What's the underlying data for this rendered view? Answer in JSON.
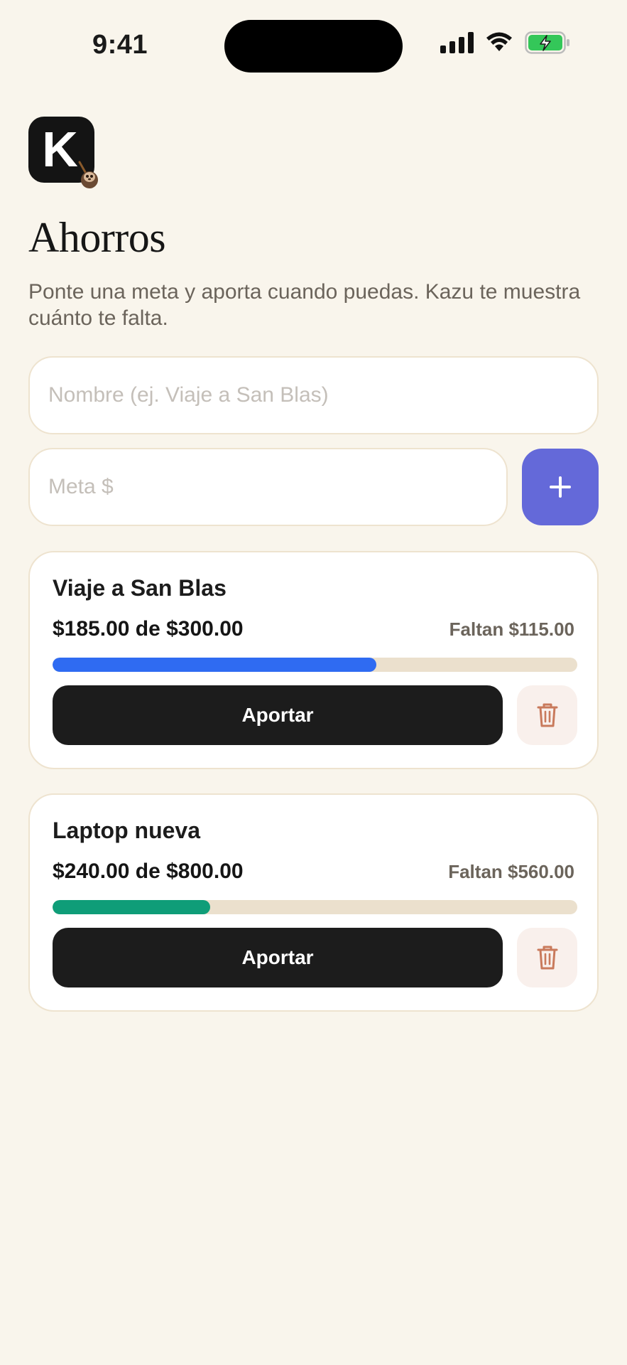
{
  "status_bar": {
    "time": "9:41"
  },
  "logo": {
    "letter": "K"
  },
  "header": {
    "title": "Ahorros",
    "subtitle": "Ponte una meta y aporta cuando puedas. Kazu te muestra cuánto te falta."
  },
  "form": {
    "name_placeholder": "Nombre (ej. Viaje a San Blas)",
    "goal_placeholder": "Meta $",
    "add_icon": "plus-icon"
  },
  "goals": [
    {
      "name": "Viaje a San Blas",
      "amount_text": "$185.00 de $300.00",
      "remaining_text": "Faltan $115.00",
      "saved": 185.0,
      "target": 300.0,
      "progress_color": "#2f6bf2",
      "contribute_label": "Aportar",
      "delete_icon": "trash-icon"
    },
    {
      "name": "Laptop nueva",
      "amount_text": "$240.00 de $800.00",
      "remaining_text": "Faltan $560.00",
      "saved": 240.0,
      "target": 800.0,
      "progress_color": "#0f9d78",
      "contribute_label": "Aportar",
      "delete_icon": "trash-icon"
    }
  ],
  "colors": {
    "background": "#f9f5ec",
    "accent": "#6469d9",
    "delete_icon": "#c97a5c"
  }
}
